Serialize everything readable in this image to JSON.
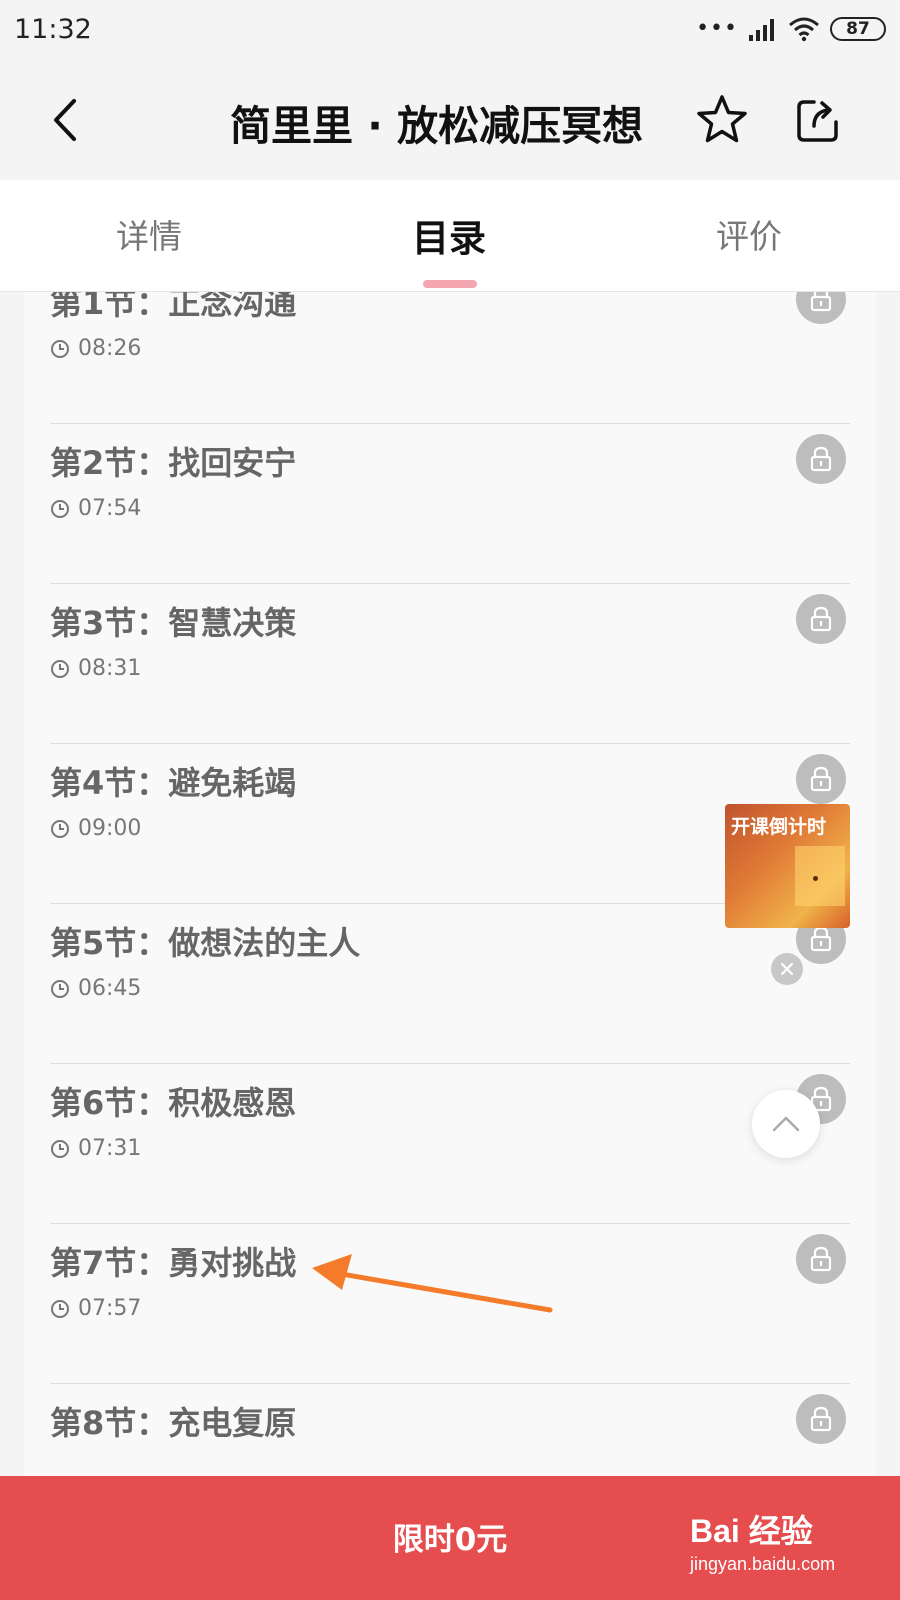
{
  "status_bar": {
    "time": "11:32",
    "signal_dots": "•••",
    "battery": "87"
  },
  "header": {
    "title": "简里里 · 放松减压冥想"
  },
  "tabs": [
    {
      "label": "详情",
      "active": false
    },
    {
      "label": "目录",
      "active": true
    },
    {
      "label": "评价",
      "active": false
    }
  ],
  "lessons": [
    {
      "title": "第1节：正念沟通",
      "duration": "08:26",
      "locked": true
    },
    {
      "title": "第2节：找回安宁",
      "duration": "07:54",
      "locked": true
    },
    {
      "title": "第3节：智慧决策",
      "duration": "08:31",
      "locked": true
    },
    {
      "title": "第4节：避免耗竭",
      "duration": "09:00",
      "locked": true
    },
    {
      "title": "第5节：做想法的主人",
      "duration": "06:45",
      "locked": true
    },
    {
      "title": "第6节：积极感恩",
      "duration": "07:31",
      "locked": true
    },
    {
      "title": "第7节：勇对挑战",
      "duration": "07:57",
      "locked": true
    },
    {
      "title": "第8节：充电复原",
      "duration": "",
      "locked": true
    }
  ],
  "promo": {
    "label": "开课倒计时"
  },
  "bottom": {
    "cta": "限时0元"
  },
  "watermark": {
    "logo": "Bai 经验",
    "url": "jingyan.baidu.com"
  },
  "colors": {
    "accent": "#e64d4f",
    "tab_indicator": "#f3a5b0",
    "annotation_arrow": "#f47b2a"
  }
}
